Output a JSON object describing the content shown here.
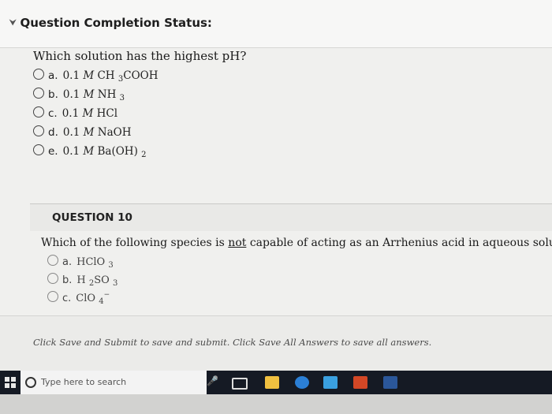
{
  "status": {
    "title": "Question Completion Status:"
  },
  "q9": {
    "text": "Which solution has the highest pH?",
    "options": [
      {
        "key": "a.",
        "pre": "0.1 ",
        "m": "M",
        "chem": " CH ",
        "s1": "3",
        "tail": "COOH",
        "s2": ""
      },
      {
        "key": "b.",
        "pre": "0.1 ",
        "m": "M",
        "chem": " NH ",
        "s1": "3",
        "tail": "",
        "s2": ""
      },
      {
        "key": "c.",
        "pre": "0.1 ",
        "m": "M",
        "chem": " HCl",
        "s1": "",
        "tail": "",
        "s2": ""
      },
      {
        "key": "d.",
        "pre": "0.1 ",
        "m": "M",
        "chem": " NaOH",
        "s1": "",
        "tail": "",
        "s2": ""
      },
      {
        "key": "e.",
        "pre": "0.1 ",
        "m": "M",
        "chem": " Ba(OH) ",
        "s1": "2",
        "tail": "",
        "s2": ""
      }
    ]
  },
  "q10": {
    "label": "QUESTION 10",
    "text_before": "Which of the following species is ",
    "text_underlined": "not",
    "text_after": " capable of acting as an Arrhenius acid in aqueous solution?",
    "options": [
      {
        "key": "a.",
        "chem": "HClO ",
        "s1": "3",
        "tail": "",
        "sup": ""
      },
      {
        "key": "b.",
        "chem": "H ",
        "s1": "2",
        "tail": "SO ",
        "s2": "3",
        "sup": ""
      },
      {
        "key": "c.",
        "chem": "ClO ",
        "s1": "4",
        "tail": "",
        "sup": "−"
      }
    ]
  },
  "footer": {
    "submit_text": "Click Save and Submit to save and submit. Click Save All Answers to save all answers."
  },
  "taskbar": {
    "search_placeholder": "Type here to search",
    "icons": [
      "windows-start-icon",
      "search-icon",
      "microphone-icon",
      "task-view-icon",
      "file-explorer-icon",
      "edge-icon",
      "store-icon",
      "powerpoint-icon",
      "word-icon"
    ],
    "colors": {
      "edge": "#2b7fd6",
      "store": "#3aa0e0",
      "powerpoint": "#d24726",
      "word": "#2b579a",
      "explorer": "#f0c040"
    }
  }
}
